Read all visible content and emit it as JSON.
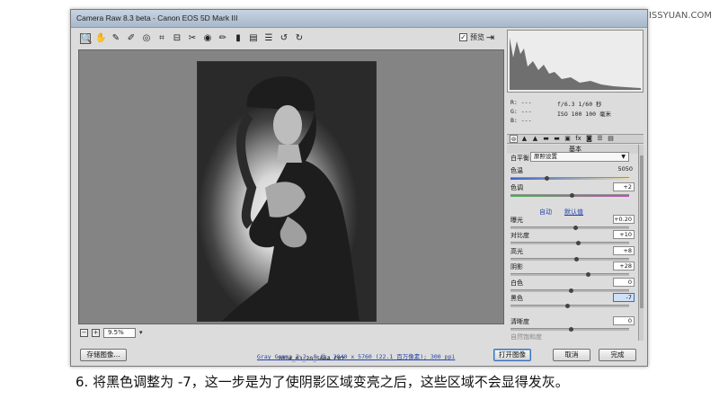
{
  "watermark": "思缘设计论坛 WWW.MISSYUAN.COM",
  "window": {
    "title": "Camera Raw 8.3 beta - Canon EOS 5D Mark III"
  },
  "toolbar": {
    "tools": [
      {
        "name": "zoom-icon",
        "glyph": "🔍"
      },
      {
        "name": "hand-icon",
        "glyph": "✋"
      },
      {
        "name": "white-balance-icon",
        "glyph": "✎"
      },
      {
        "name": "color-sampler-icon",
        "glyph": "✐"
      },
      {
        "name": "target-adjust-icon",
        "glyph": "◎"
      },
      {
        "name": "crop-icon",
        "glyph": "⌗"
      },
      {
        "name": "straighten-icon",
        "glyph": "⊟"
      },
      {
        "name": "spot-removal-icon",
        "glyph": "✂"
      },
      {
        "name": "red-eye-icon",
        "glyph": "◉"
      },
      {
        "name": "adjustment-brush-icon",
        "glyph": "✏"
      },
      {
        "name": "graduated-filter-icon",
        "glyph": "▮"
      },
      {
        "name": "radial-filter-icon",
        "glyph": "▤"
      },
      {
        "name": "list-icon",
        "glyph": "☰"
      },
      {
        "name": "rotate-ccw-icon",
        "glyph": "↺"
      },
      {
        "name": "rotate-cw-icon",
        "glyph": "↻"
      }
    ],
    "preview_label": "预览",
    "preview_checked": "✓"
  },
  "image": {
    "filename": "2014_03_20_5684.CR2"
  },
  "zoom": {
    "value": "9.5%",
    "minus": "−",
    "plus": "+",
    "arrow": "▾"
  },
  "readout": {
    "r": "R:  ---",
    "g": "G:  ---",
    "b": "B:  ---",
    "line1": "f/6.3   1/60 秒",
    "line2": "ISO 100   100 毫米"
  },
  "tabs": [
    "⊚",
    "▲",
    "▲",
    "▬",
    "▬",
    "▣",
    "fx",
    "◙",
    "☰",
    "▤"
  ],
  "basic": {
    "section_title": "基本",
    "wb_label": "白平衡:",
    "wb_value": "原照设置",
    "temp_label": "色温",
    "temp_value": "5050",
    "tint_label": "色调",
    "tint_value": "+2",
    "auto_label": "自动",
    "default_label": "默认值",
    "exposure_label": "曝光",
    "exposure_value": "+0.20",
    "contrast_label": "对比度",
    "contrast_value": "+10",
    "highlights_label": "高光",
    "highlights_value": "+8",
    "shadows_label": "阴影",
    "shadows_value": "+28",
    "whites_label": "白色",
    "whites_value": "0",
    "blacks_label": "黑色",
    "blacks_value": "-7",
    "clarity_label": "清晰度",
    "clarity_value": "0",
    "vibrance_label": "自然饱和度"
  },
  "footer": {
    "save_label": "存储图像...",
    "info": "Gray Gamma 2.2; 8 位; 3840 x 5760 (22.1 百万像素); 300 ppi",
    "open_label": "打开图像",
    "cancel_label": "取消",
    "done_label": "完成"
  },
  "caption": "6. 将黑色调整为 -7，这一步是为了使阴影区域变亮之后，这些区域不会显得发灰。"
}
